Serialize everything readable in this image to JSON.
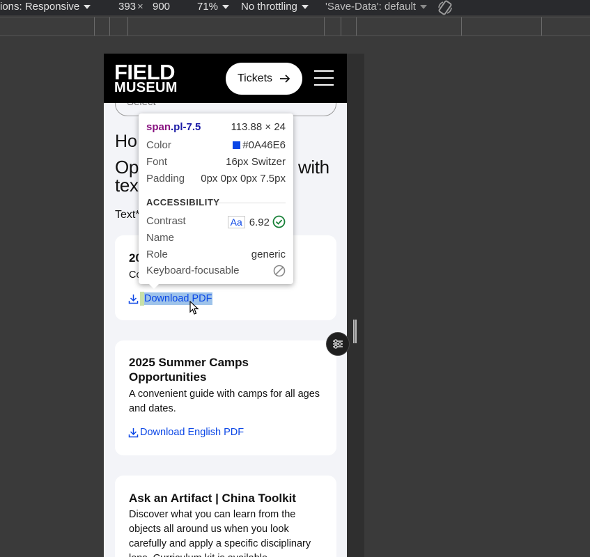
{
  "devtools": {
    "dimensions_label": "ions: Responsive",
    "width": "393",
    "times": "×",
    "height": "900",
    "zoom": "71%",
    "throttling": "No throttling",
    "save_data": "'Save-Data': default"
  },
  "site": {
    "logo_line1": "FIELD",
    "logo_line2": "MUSEUM",
    "tickets_label": "Tickets",
    "search_placeholder": "Select",
    "heading_partial": "Ho",
    "title_left": "Op",
    "title_right": "with",
    "title_line2_left": "tex",
    "note_partial": "Text*"
  },
  "cards": [
    {
      "title": "20",
      "desc": "Co",
      "link": "Download PDF"
    },
    {
      "title": "2025 Summer Camps Opportunities",
      "desc": "A convenient guide with camps for all ages and dates.",
      "link": "Download English PDF"
    },
    {
      "title": "Ask an Artifact | China Toolkit",
      "desc": "Discover what you can learn from the objects all around us when you look carefully and apply a specific disciplinary lens. Curriculum kit is available"
    }
  ],
  "tooltip": {
    "tag": "span",
    "cls": ".pl-7.5",
    "size": "113.88 × 24",
    "color_label": "Color",
    "color_value": "#0A46E6",
    "font_label": "Font",
    "font_value": "16px Switzer",
    "padding_label": "Padding",
    "padding_value": "0px 0px 0px 7.5px",
    "accessibility_title": "ACCESSIBILITY",
    "contrast_label": "Contrast",
    "contrast_aa": "Aa",
    "contrast_value": "6.92",
    "name_label": "Name",
    "role_label": "Role",
    "role_value": "generic",
    "keyboard_label": "Keyboard-focusable"
  },
  "colors": {
    "link": "#0A46E6",
    "header_bg": "#000000",
    "page_bg": "#f3f4f8"
  },
  "icons": [
    "caret-down-icon",
    "rotate-icon",
    "arrow-right-icon",
    "menu-icon",
    "download-icon",
    "check-circle-icon",
    "not-allowed-icon",
    "sliders-icon",
    "cursor-icon"
  ]
}
